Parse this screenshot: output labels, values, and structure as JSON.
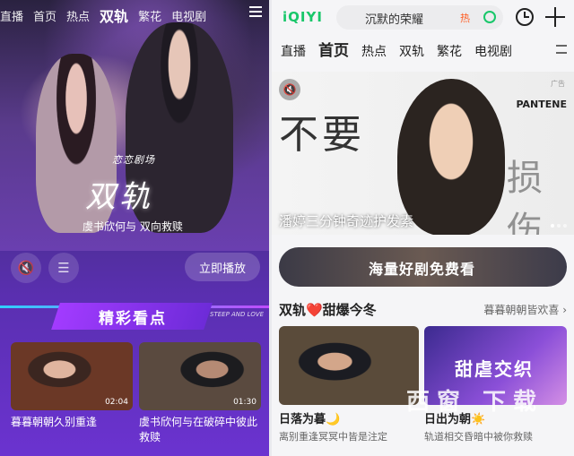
{
  "left": {
    "nav": [
      "直播",
      "首页",
      "热点",
      "双轨",
      "繁花",
      "电视剧"
    ],
    "active_tab": "双轨",
    "brand_logo": "恋恋剧场",
    "show_title": "双轨",
    "show_subtitle": "虞书欣何与  双向救赎",
    "play_label": "立即播放",
    "banner_text": "精彩看点",
    "banner_eng": "STEEP AND LOVE",
    "videos": [
      {
        "title": "暮暮朝朝久别重逢",
        "duration": "02:04"
      },
      {
        "title": "虞书欣何与在破碎中彼此救赎",
        "duration": "01:30"
      }
    ]
  },
  "right": {
    "logo": "iQIYI",
    "search_query": "沉默的荣耀",
    "search_hot": "热",
    "nav": [
      "直播",
      "首页",
      "热点",
      "双轨",
      "繁花",
      "电视剧"
    ],
    "active_tab": "首页",
    "ad": {
      "big_text": "不要",
      "big_text2": "损伤",
      "brand": "PANTENE",
      "ad_mark": "广告",
      "caption": "潘婷三分钟奇迹护发素"
    },
    "promo_text": "海量好剧免费看",
    "section_title": "双轨❤️甜爆今冬",
    "section_more": "暮暮朝朝皆欢喜 ›",
    "cards": [
      {
        "title": "日落为暮🌙",
        "sub": "离别重逢冥冥中皆是注定"
      },
      {
        "title": "日出为朝☀️",
        "sub": "轨道相交昏暗中被你救赎",
        "overlay": "甜虐交织"
      }
    ],
    "watermark": "西窗 下载"
  }
}
